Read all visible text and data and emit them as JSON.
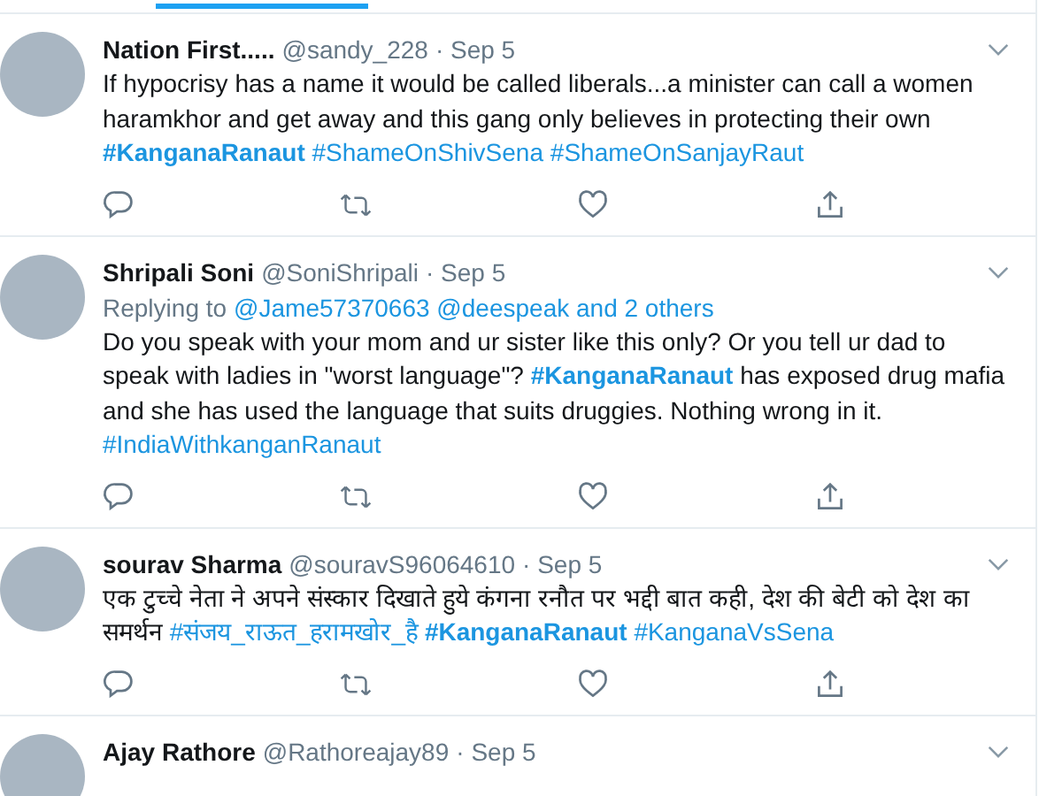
{
  "tabs": [
    {
      "selected": true
    }
  ],
  "tweets": [
    {
      "name": "Nation First.....",
      "handle": "@sandy_228",
      "date": "· Sep 5",
      "body": [
        {
          "kind": "text",
          "text": "If hypocrisy has a name it would be called liberals...a minister can call a women haramkhor and get away and this gang only believes in protecting their own"
        },
        {
          "kind": "hashtag",
          "bold": true,
          "text": "#KanganaRanaut"
        },
        {
          "kind": "hashtag",
          "bold": false,
          "text": "#ShameOnShivSena"
        },
        {
          "kind": "hashtag",
          "bold": false,
          "text": "#ShameOnSanjayRaut"
        }
      ]
    },
    {
      "name": "Shripali Soni",
      "handle": "@SoniShripali",
      "date": "· Sep 5",
      "replying": {
        "label": "Replying to",
        "mentions": "@Jame57370663 @deespeak and 2 others"
      },
      "body": [
        {
          "kind": "text",
          "text": "Do you speak with your mom and ur sister like this only? Or you tell ur dad to speak with ladies in \"worst language\"?"
        },
        {
          "kind": "hashtag",
          "bold": true,
          "text": "#KanganaRanaut"
        },
        {
          "kind": "text",
          "text": "has exposed drug mafia and she has used the language that suits druggies. Nothing wrong in it."
        },
        {
          "kind": "hashtag",
          "bold": false,
          "text": "#IndiaWithkanganRanaut"
        }
      ]
    },
    {
      "name": "sourav Sharma",
      "handle": "@souravS96064610",
      "date": "· Sep 5",
      "body": [
        {
          "kind": "text",
          "text": "एक टुच्चे नेता ने अपने संस्कार दिखाते हुये कंगना रनौत पर भद्दी बात कही, देश की बेटी को देश का समर्थन"
        },
        {
          "kind": "hashtag",
          "bold": false,
          "text": "#संजय_राऊत_हरामखोर_है"
        },
        {
          "kind": "hashtag",
          "bold": true,
          "text": "#KanganaRanaut"
        },
        {
          "kind": "hashtag",
          "bold": false,
          "text": "#KanganaVsSena"
        }
      ]
    },
    {
      "name": "Ajay Rathore",
      "handle": "@Rathoreajay89",
      "date": "· Sep 5"
    }
  ]
}
